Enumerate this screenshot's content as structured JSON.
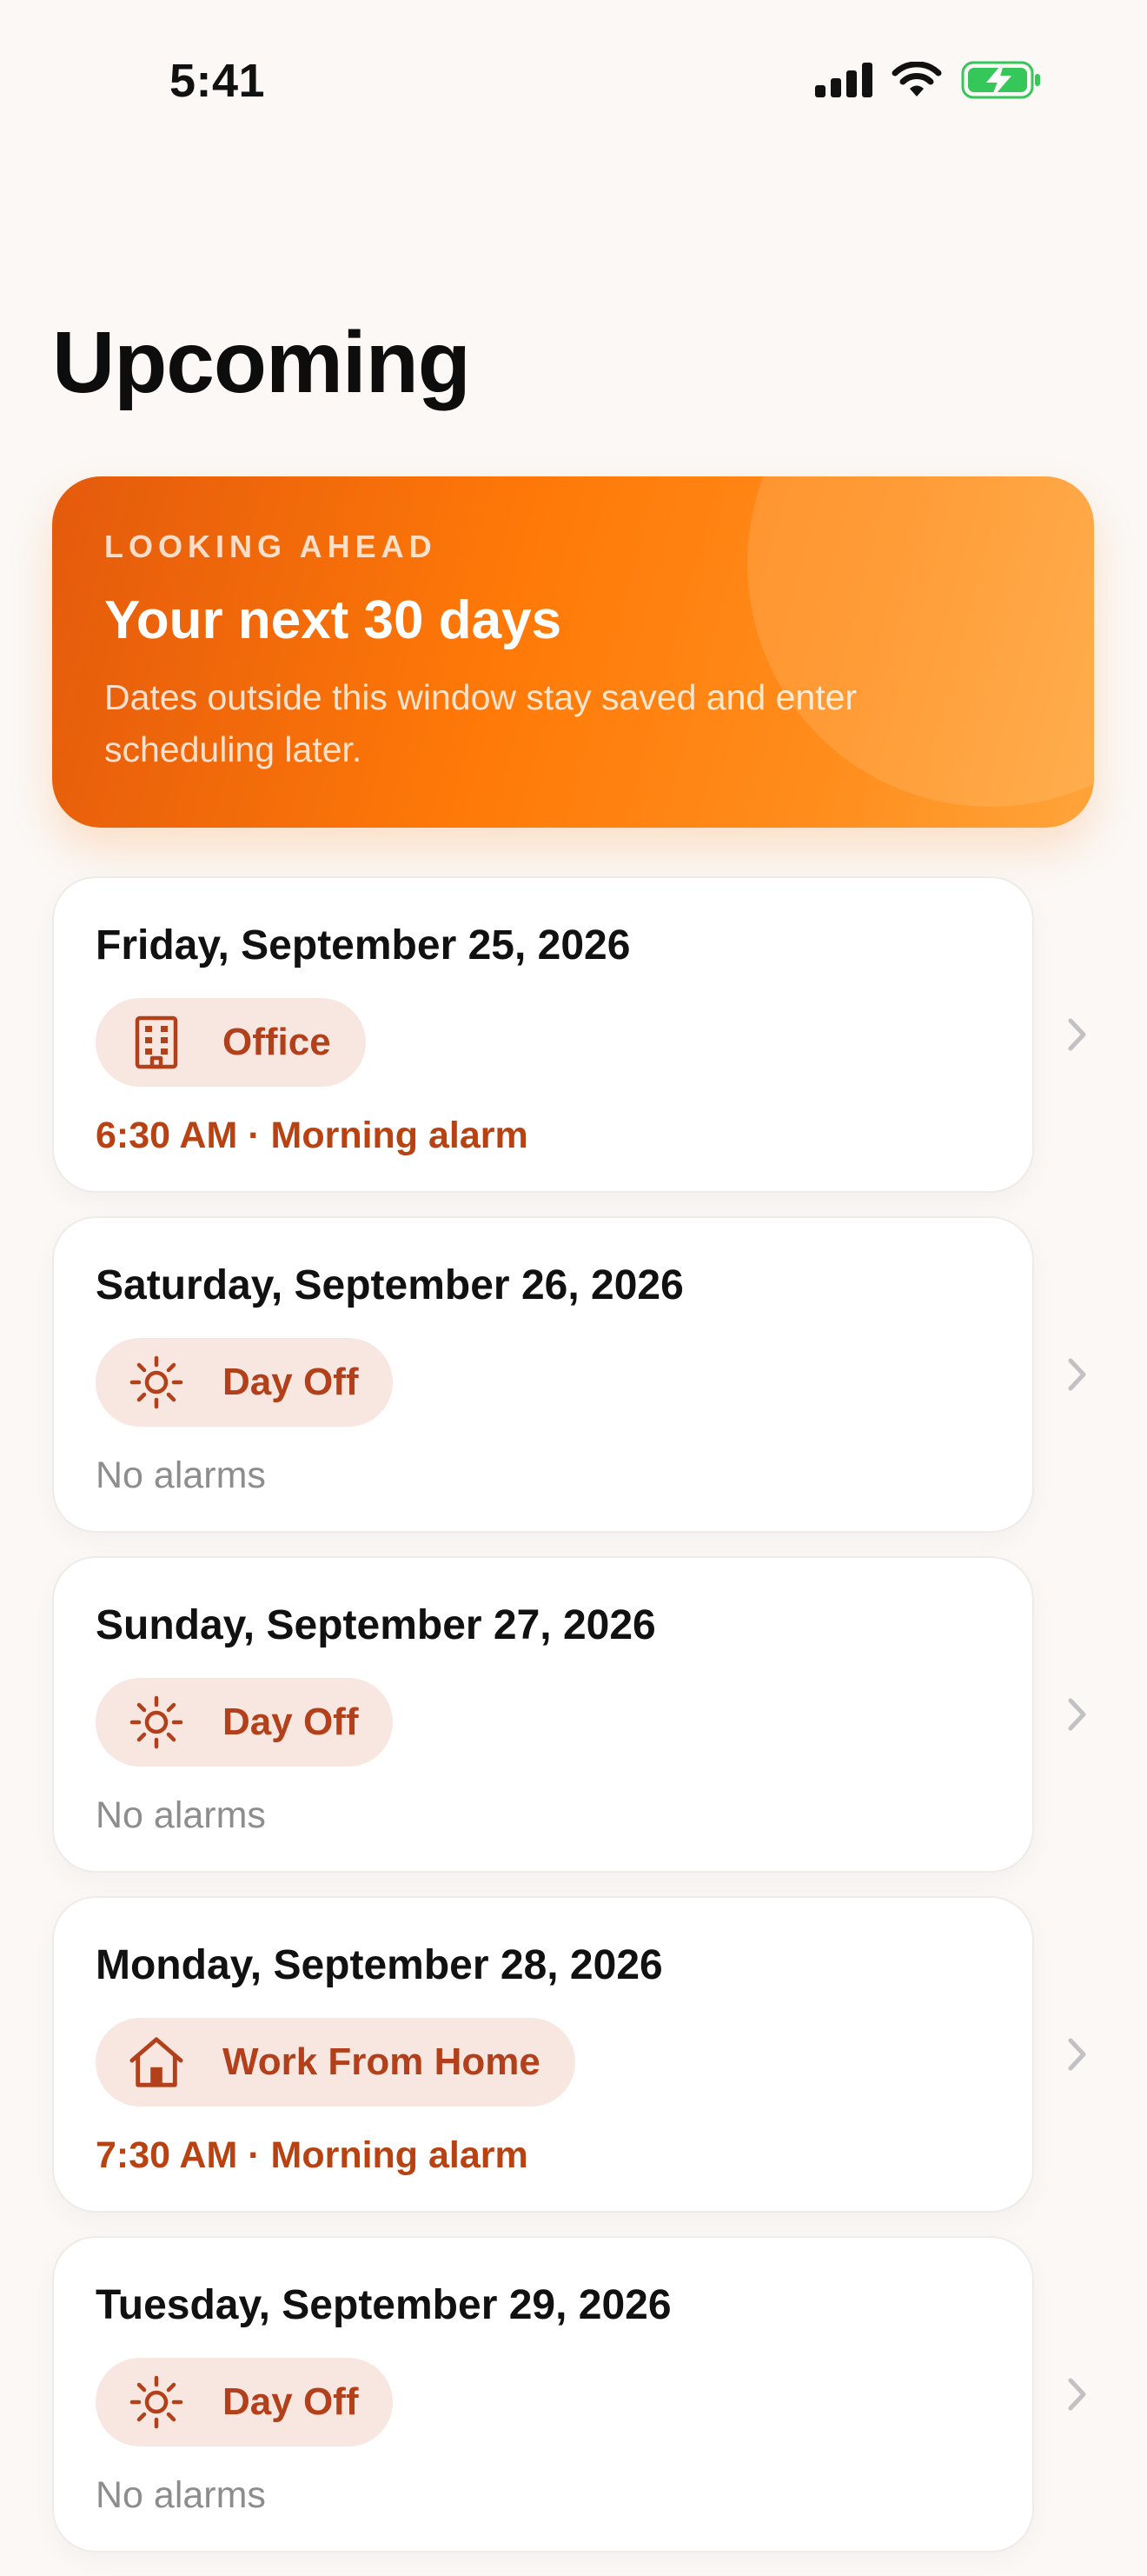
{
  "status_bar": {
    "time": "5:41"
  },
  "page": {
    "title": "Upcoming"
  },
  "hero": {
    "eyebrow": "LOOKING AHEAD",
    "title": "Your next 30 days",
    "description": "Dates outside this window stay saved and enter scheduling later."
  },
  "colors": {
    "accent": "#ff7a08",
    "pill_bg": "#f8e7e1",
    "pill_text": "#b2401a",
    "alarm_text": "#b84212"
  },
  "days": [
    {
      "date": "Friday, September 25, 2026",
      "type": "Office",
      "icon": "building-icon",
      "alarm": "6:30 AM · Morning alarm"
    },
    {
      "date": "Saturday, September 26, 2026",
      "type": "Day Off",
      "icon": "sun-icon",
      "alarm": "No alarms"
    },
    {
      "date": "Sunday, September 27, 2026",
      "type": "Day Off",
      "icon": "sun-icon",
      "alarm": "No alarms"
    },
    {
      "date": "Monday, September 28, 2026",
      "type": "Work From Home",
      "icon": "house-icon",
      "alarm": "7:30 AM · Morning alarm"
    },
    {
      "date": "Tuesday, September 29, 2026",
      "type": "Day Off",
      "icon": "sun-icon",
      "alarm": "No alarms"
    }
  ]
}
